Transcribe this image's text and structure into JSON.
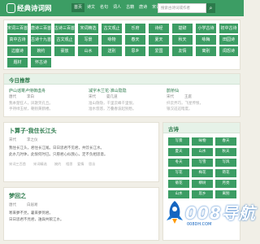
{
  "header": {
    "logo_text": "经典诗词网",
    "nav": [
      "首页",
      "诗文",
      "名句",
      "词人",
      "古籍",
      "唐诗",
      "宋词",
      "元曲",
      "我的"
    ],
    "search_placeholder": "搜索古诗词或作者",
    "search_button_icon": "search-icon"
  },
  "categories": [
    [
      "宋词三百首",
      "唐诗三百首",
      "古诗三百首",
      "宋词精选",
      "古文观止",
      "乐府",
      "诗经",
      "楚辞",
      "小学古诗",
      "初中古诗"
    ],
    [
      "高中古诗",
      "古诗十九首",
      "古文观止",
      "写景",
      "咏物",
      "春天",
      "夏天",
      "秋天",
      "咏梅",
      "田园诗"
    ],
    [
      "边塞诗",
      "婉约",
      "豪放",
      "山水",
      "送别",
      "思乡",
      "爱国",
      "友情",
      "离别",
      "闺怨诗"
    ],
    [
      "题材",
      "怀古诗"
    ]
  ],
  "today": {
    "title": "今日推荐",
    "poems": [
      {
        "title": "庐山谣寄卢侍御虚舟",
        "dynasty": "唐代",
        "author": "李白",
        "line1": "我本楚狂人，凤歌笑孔丘。",
        "line2": "手持绿玉杖，朝别黄鹤楼。"
      },
      {
        "title": "减字木兰花·淮山隐隐",
        "dynasty": "宋代",
        "author": "晏几道",
        "line1": "淮山隐隐，千里云峰千里恨。",
        "line2": "淮水悠悠，万叠春波起别愁。"
      },
      {
        "title": "鹊桥仙",
        "dynasty": "宋代",
        "author": "王庭",
        "line1": "纤云弄巧，飞星传恨，",
        "line2": "银汉迢迢暗度。"
      }
    ]
  },
  "main_poem": {
    "title": "卜算子·我住长江头",
    "dynasty": "宋代",
    "author": "李之仪",
    "lines": [
      "我住长江头，君住长江尾。日日思君不见君，共饮长江水。",
      "此水几时休，此恨何时已。只愿君心似我心，定不负相思意。"
    ],
    "tags": [
      "宋词三百首",
      "宋词精选",
      "婉约",
      "相思",
      "爱情",
      "思念"
    ]
  },
  "second_poem": {
    "title": "梦回之",
    "dynasty": "唐代",
    "author": "白居易",
    "lines": [
      "寒来夢不見，暑來夢到君。",
      "日日思君不見君，誰與共飲江水。"
    ]
  },
  "sidebar": {
    "title": "古诗",
    "tags": [
      "写景",
      "咏物",
      "春天",
      "夏天",
      "山水",
      "秋天",
      "冬天",
      "写雪",
      "写风",
      "写花",
      "梅花",
      "荷花",
      "菊花",
      "柳树",
      "月亮",
      "山水",
      "思乡",
      "离别"
    ]
  },
  "watermark": {
    "text": "008导航",
    "sub": "008DH.COM"
  },
  "colors": {
    "accent": "#3c9d64",
    "accent_dark": "#2b7a4b",
    "background": "#f1efe7"
  }
}
